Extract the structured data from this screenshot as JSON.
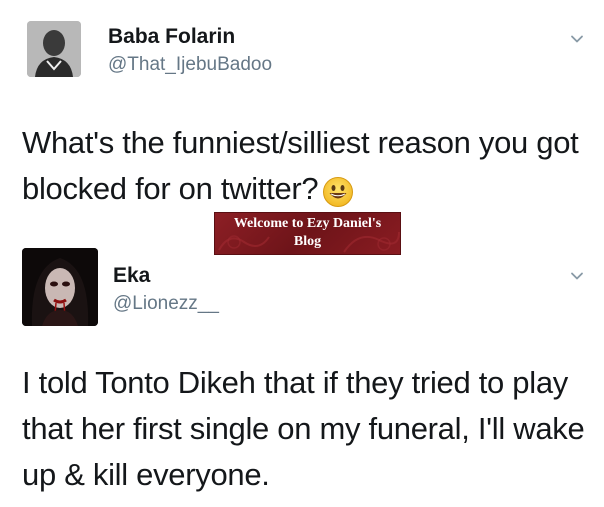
{
  "tweets": [
    {
      "name": "Baba Folarin",
      "handle": "@That_IjebuBadoo",
      "text": "What's the funniest/silliest reason you got blocked for on twitter?",
      "emoji": "grinning-face-icon"
    },
    {
      "name": "Eka",
      "handle": "@Lionezz__",
      "text": "I told Tonto Dikeh that if they tried to play that her first single on my funeral, I'll wake up & kill everyone."
    }
  ],
  "watermark": {
    "line1": "Welcome to Ezy Daniel's",
    "line2": "Blog"
  },
  "colors": {
    "text": "#14171a",
    "secondary": "#657786",
    "watermark_bg": "#7a171d"
  }
}
